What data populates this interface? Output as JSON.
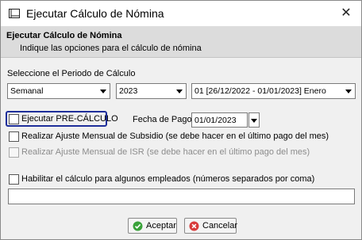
{
  "window": {
    "title": "Ejecutar Cálculo de Nómina",
    "close_glyph": "✕"
  },
  "header": {
    "title": "Ejecutar Cálculo de Nómina",
    "subtitle": "Indique las opciones para el cálculo de nómina"
  },
  "periodo": {
    "label": "Seleccione el Periodo de Cálculo",
    "tipo": "Semanal",
    "anio": "2023",
    "periodo": "01 [26/12/2022 - 01/01/2023] Enero"
  },
  "options": {
    "precalculo_label": "Ejecutar PRE-CÁLCULO",
    "fecha_pago_label": "Fecha de Pago",
    "fecha_pago_value": "01/01/2023",
    "ajuste_subsidio_label": "Realizar Ajuste Mensual de Subsidio (se debe hacer en el último pago del mes)",
    "ajuste_isr_label": "Realizar Ajuste Mensual de ISR (se debe hacer en el último pago del mes)",
    "habilitar_label": "Habilitar el cálculo para algunos empleados (números separados por coma)",
    "empleados_value": ""
  },
  "buttons": {
    "aceptar": "Aceptar",
    "cancelar": "Cancelar"
  },
  "icons": {
    "window": "window-icon",
    "aceptar": "check-circle-icon",
    "cancelar": "x-circle-icon"
  },
  "colors": {
    "focus": "#1e2e9a",
    "aceptar_icon": "#3aa23a",
    "cancelar_icon": "#d83b3b"
  }
}
